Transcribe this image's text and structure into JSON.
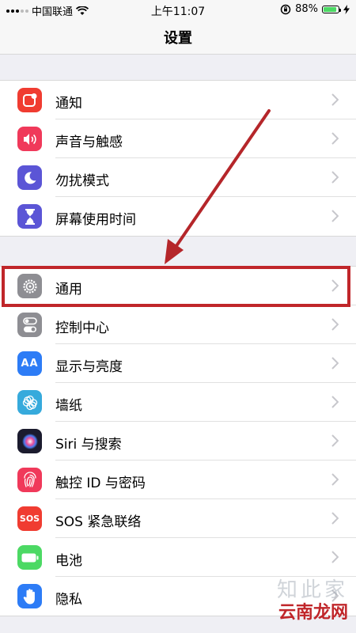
{
  "status_bar": {
    "carrier": "中国联通",
    "time": "上午11:07",
    "battery": "88%",
    "battery_level": 0.88
  },
  "nav": {
    "title": "设置"
  },
  "groups": [
    {
      "items": [
        {
          "label": "通知",
          "icon": "notification-icon",
          "color": "#f03c31"
        },
        {
          "label": "声音与触感",
          "icon": "sound-icon",
          "color": "#f0395a"
        },
        {
          "label": "勿扰模式",
          "icon": "moon-icon",
          "color": "#5b55d6"
        },
        {
          "label": "屏幕使用时间",
          "icon": "hourglass-icon",
          "color": "#5b55d6"
        }
      ]
    },
    {
      "items": [
        {
          "label": "通用",
          "icon": "gear-icon",
          "color": "#8e8e93"
        },
        {
          "label": "控制中心",
          "icon": "control-center-icon",
          "color": "#8e8e93"
        },
        {
          "label": "显示与亮度",
          "icon": "display-icon",
          "icon_text": "AA",
          "color": "#2d7cf6"
        },
        {
          "label": "墙纸",
          "icon": "wallpaper-icon",
          "color": "#36aadc"
        },
        {
          "label": "Siri 与搜索",
          "icon": "siri-icon",
          "color": "#1b1b2e"
        },
        {
          "label": "触控 ID 与密码",
          "icon": "fingerprint-icon",
          "color": "#f0395a"
        },
        {
          "label": "SOS 紧急联络",
          "icon": "sos-icon",
          "icon_text": "SOS",
          "color": "#f03c31"
        },
        {
          "label": "电池",
          "icon": "battery-icon",
          "color": "#4cd964"
        },
        {
          "label": "隐私",
          "icon": "hand-icon",
          "color": "#2d7cf6"
        }
      ]
    }
  ],
  "watermark": {
    "top": "知此家",
    "bottom": "云南龙网"
  }
}
